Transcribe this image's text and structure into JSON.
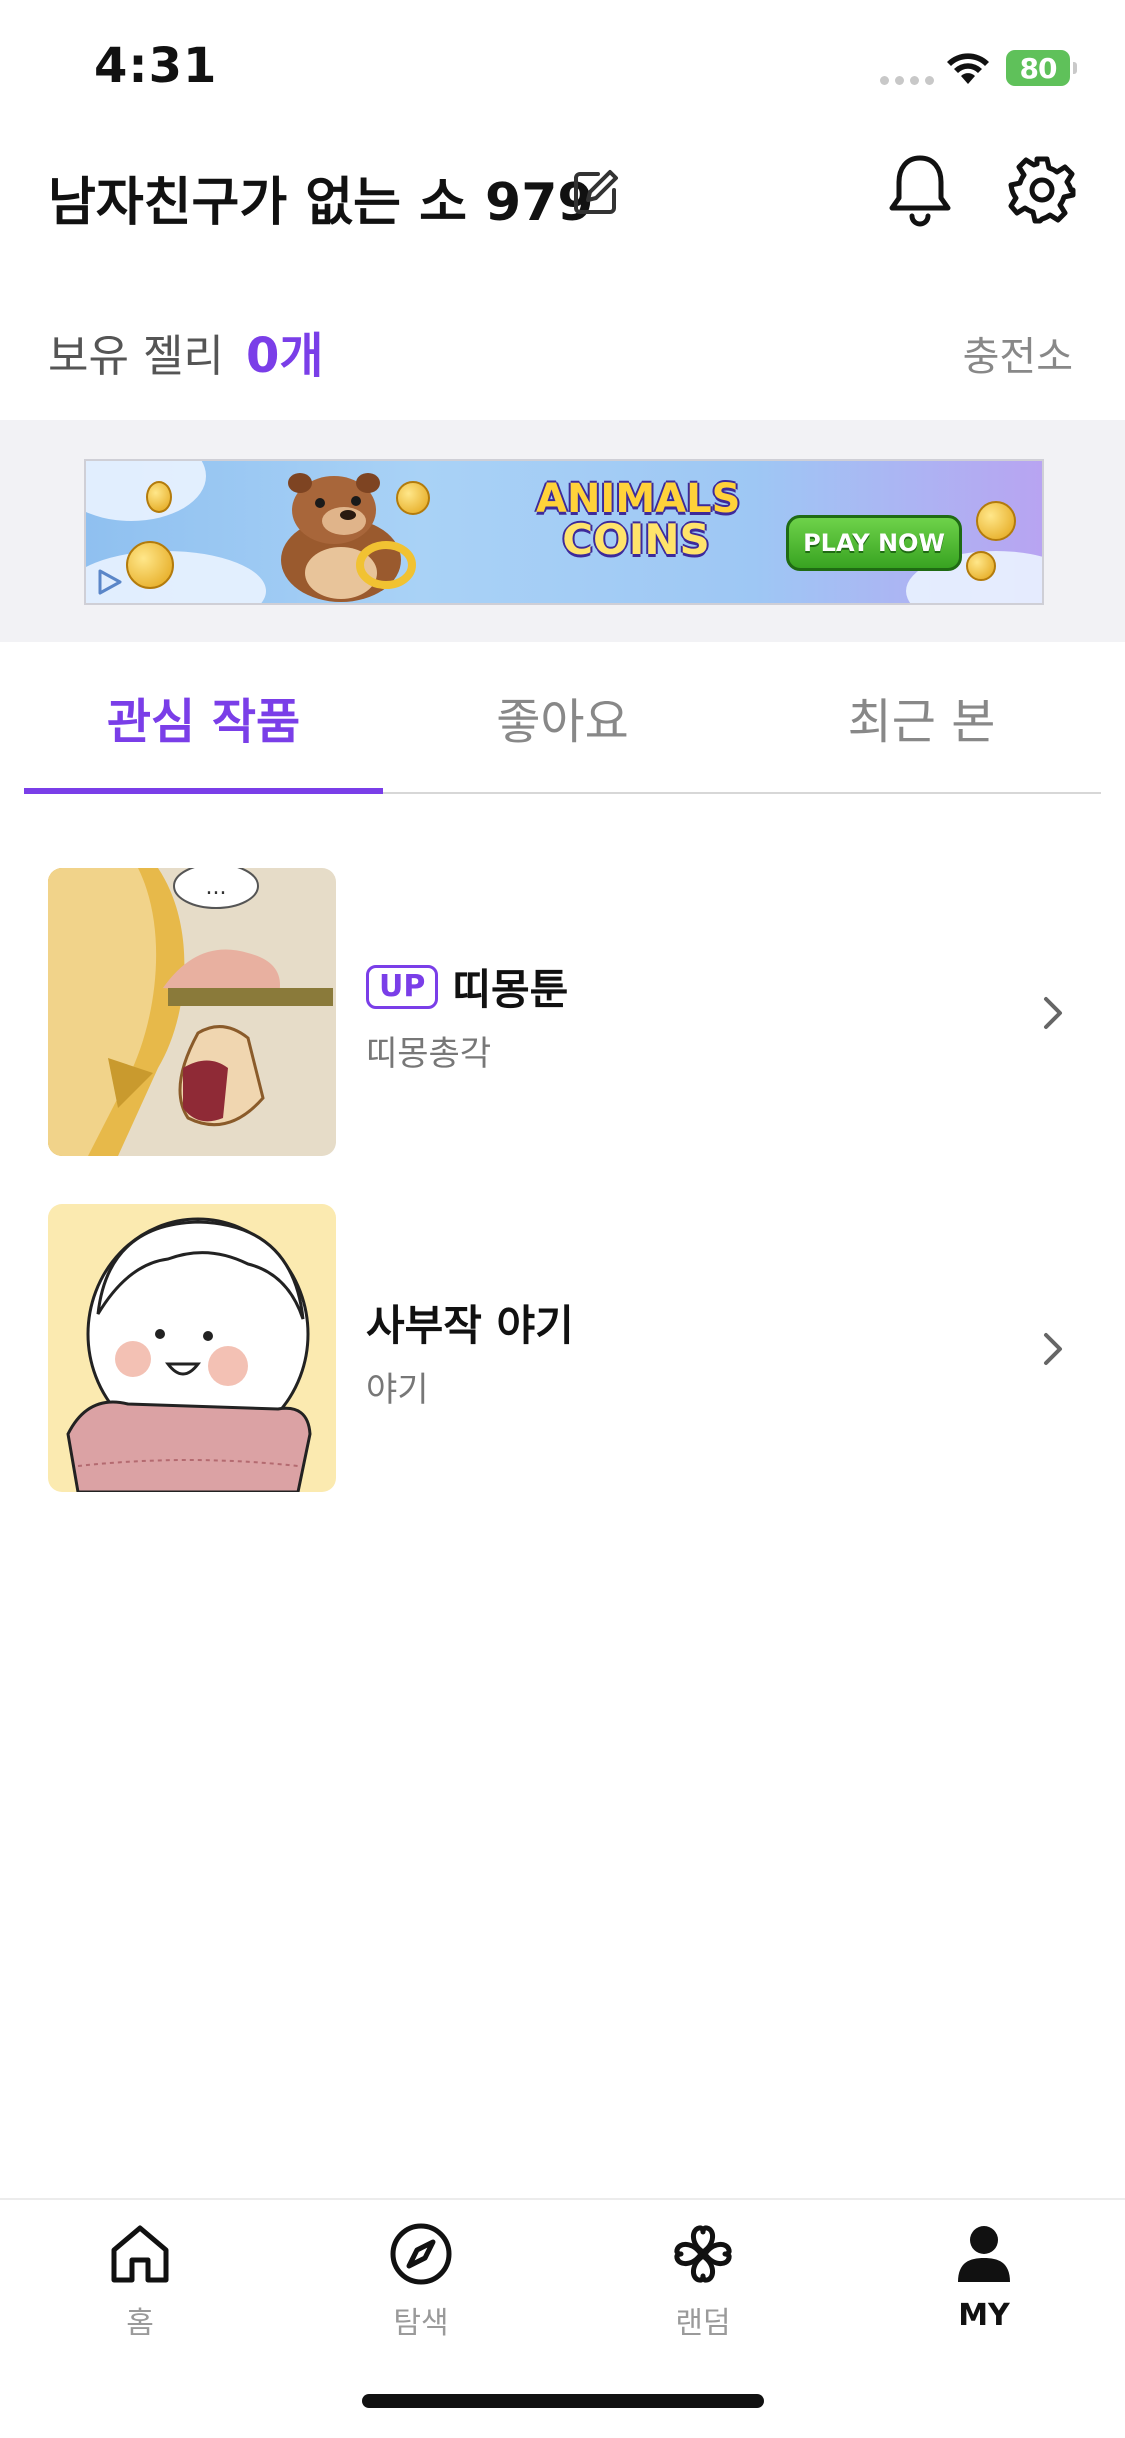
{
  "status_bar": {
    "time": "4:31",
    "battery": "80"
  },
  "header": {
    "nickname": "남자친구가 없는 소 979"
  },
  "jelly": {
    "label": "보유 젤리",
    "count": "0개",
    "charge_label": "충전소"
  },
  "ad": {
    "title_line1": "ANIMALS",
    "title_line2": "COINS",
    "cta": "PLAY NOW"
  },
  "tabs": [
    {
      "label": "관심 작품",
      "active": true
    },
    {
      "label": "좋아요",
      "active": false
    },
    {
      "label": "최근 본",
      "active": false
    }
  ],
  "works": [
    {
      "badge": "UP",
      "title": "띠몽툰",
      "author": "띠몽총각"
    },
    {
      "badge": "",
      "title": "사부작 야기",
      "author": "야기"
    }
  ],
  "bottom_nav": [
    {
      "label": "홈",
      "icon": "home-icon",
      "active": false
    },
    {
      "label": "탐색",
      "icon": "compass-icon",
      "active": false
    },
    {
      "label": "랜덤",
      "icon": "clover-icon",
      "active": false
    },
    {
      "label": "MY",
      "icon": "person-icon",
      "active": true
    }
  ],
  "colors": {
    "accent": "#7a3ee8",
    "muted_text": "#888888",
    "ad_background": "#f2f2f5"
  }
}
